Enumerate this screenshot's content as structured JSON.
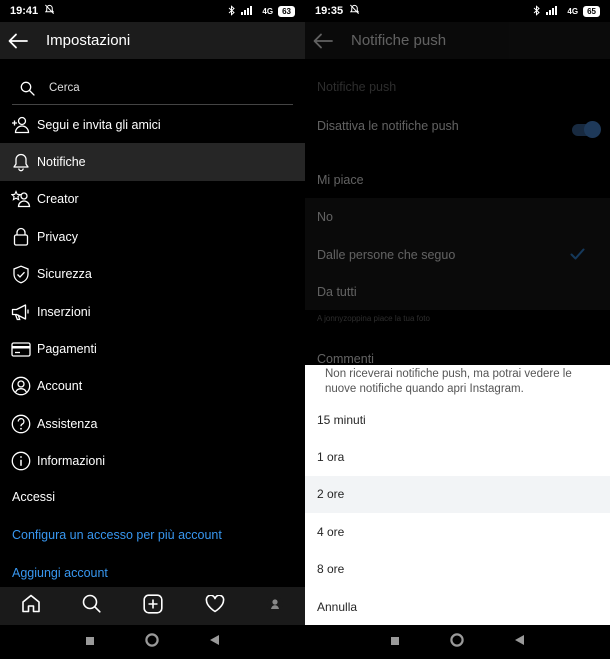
{
  "left": {
    "status": {
      "time": "19:41",
      "signal": "4G",
      "battery": "63"
    },
    "header": {
      "title": "Impostazioni"
    },
    "search": {
      "placeholder": "Cerca"
    },
    "menu": [
      {
        "label": "Segui e invita gli amici",
        "icon": "add-person-icon"
      },
      {
        "label": "Notifiche",
        "icon": "bell-icon"
      },
      {
        "label": "Creator",
        "icon": "creator-star-icon"
      },
      {
        "label": "Privacy",
        "icon": "lock-icon"
      },
      {
        "label": "Sicurezza",
        "icon": "shield-icon"
      },
      {
        "label": "Inserzioni",
        "icon": "megaphone-icon"
      },
      {
        "label": "Pagamenti",
        "icon": "card-icon"
      },
      {
        "label": "Account",
        "icon": "person-circle-icon"
      },
      {
        "label": "Assistenza",
        "icon": "help-icon"
      },
      {
        "label": "Informazioni",
        "icon": "info-icon"
      }
    ],
    "accessi": {
      "title": "Accessi",
      "multi_account": "Configura un accesso per più account",
      "add_account": "Aggiungi account"
    }
  },
  "right": {
    "status": {
      "time": "19:35",
      "signal": "4G",
      "battery": "65"
    },
    "header": {
      "title": "Notifiche push"
    },
    "push_section": "Notifiche push",
    "disable_label": "Disattiva le notifiche push",
    "disable_enabled": true,
    "likes_title": "Mi piace",
    "like_options": [
      {
        "label": "No"
      },
      {
        "label": "Dalle persone che seguo"
      },
      {
        "label": "Da tutti"
      }
    ],
    "likes_hint": "A jonnyzoppina piace la tua foto",
    "comments_title": "Commenti",
    "sheet": {
      "description": "Non riceverai notifiche push, ma potrai vedere le nuove notifiche quando apri Instagram.",
      "options": [
        "15 minuti",
        "1 ora",
        "2 ore",
        "4 ore",
        "8 ore",
        "Annulla"
      ]
    }
  },
  "colors": {
    "accent": "#3897f0",
    "toggle": "#4f96ea",
    "topbar": "#1c1c1c"
  }
}
